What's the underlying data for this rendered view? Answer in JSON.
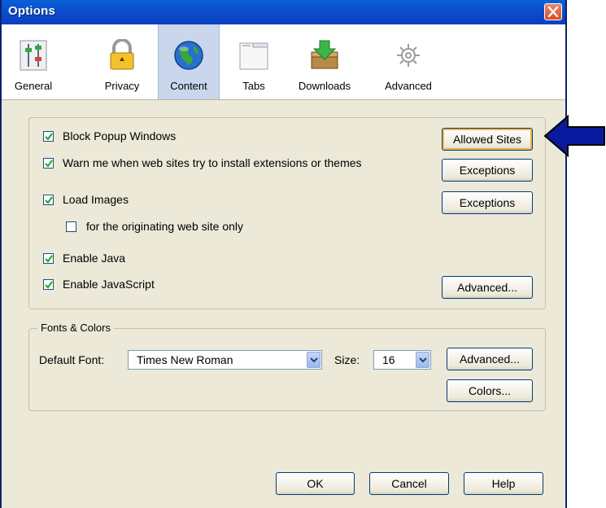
{
  "window": {
    "title": "Options"
  },
  "toolbar": {
    "items": [
      {
        "label": "General",
        "icon": "sliders-icon"
      },
      {
        "label": "Privacy",
        "icon": "padlock-icon"
      },
      {
        "label": "Content",
        "icon": "globe-icon",
        "selected": true
      },
      {
        "label": "Tabs",
        "icon": "tabs-icon"
      },
      {
        "label": "Downloads",
        "icon": "download-icon"
      },
      {
        "label": "Advanced",
        "icon": "gear-icon"
      }
    ]
  },
  "content": {
    "block_popups": {
      "label": "Block Popup Windows",
      "checked": true,
      "button": "Allowed Sites"
    },
    "warn_addons": {
      "label": "Warn me when web sites try to install extensions or themes",
      "checked": true,
      "button": "Exceptions"
    },
    "load_images": {
      "label": "Load Images",
      "checked": true,
      "button": "Exceptions"
    },
    "originating_only": {
      "label": "for the originating web site only",
      "checked": false
    },
    "enable_java": {
      "label": "Enable Java",
      "checked": true
    },
    "enable_js": {
      "label": "Enable JavaScript",
      "checked": true,
      "button": "Advanced..."
    }
  },
  "fonts": {
    "group_title": "Fonts & Colors",
    "default_font_label": "Default Font:",
    "default_font_value": "Times New Roman",
    "size_label": "Size:",
    "size_value": "16",
    "advanced_button": "Advanced...",
    "colors_button": "Colors..."
  },
  "footer": {
    "ok": "OK",
    "cancel": "Cancel",
    "help": "Help"
  },
  "colors": {
    "accent": "#0b4dcc",
    "arrow": "#0a1a9e",
    "face": "#ece9d8"
  }
}
